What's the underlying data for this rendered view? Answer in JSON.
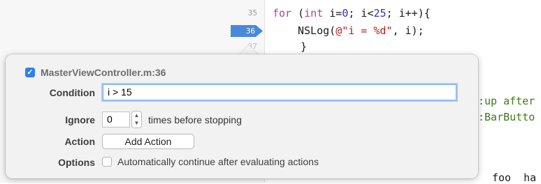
{
  "editor": {
    "line_numbers": [
      "35",
      "36",
      "37"
    ],
    "current_line": "36",
    "code_lines": {
      "line35_kw": "for",
      "line35_a": " (",
      "line35_int": "int",
      "line35_b": " i=",
      "line35_n0": "0",
      "line35_c": "; i<",
      "line35_n25": "25",
      "line35_d": "; i++){",
      "line36_fn": "NSLog(",
      "line36_str": "@\"i = %d\"",
      "line36_tail": ", i);",
      "line37": "}",
      "partial1": ":up after",
      "partial2": ":BarButto",
      "partial3": "foo  ha"
    }
  },
  "breakpoint": {
    "enabled": true,
    "title": "MasterViewController.m:36",
    "labels": {
      "condition": "Condition",
      "ignore": "Ignore",
      "action": "Action",
      "options": "Options"
    },
    "condition_value": "i > 15",
    "ignore_value": "0",
    "ignore_suffix": "times before stopping",
    "add_action_label": "Add Action",
    "auto_continue_label": "Automatically continue after evaluating actions",
    "auto_continue_checked": false
  },
  "colors": {
    "accent": "#2f7ef6",
    "breakpoint": "#4a89d9"
  }
}
